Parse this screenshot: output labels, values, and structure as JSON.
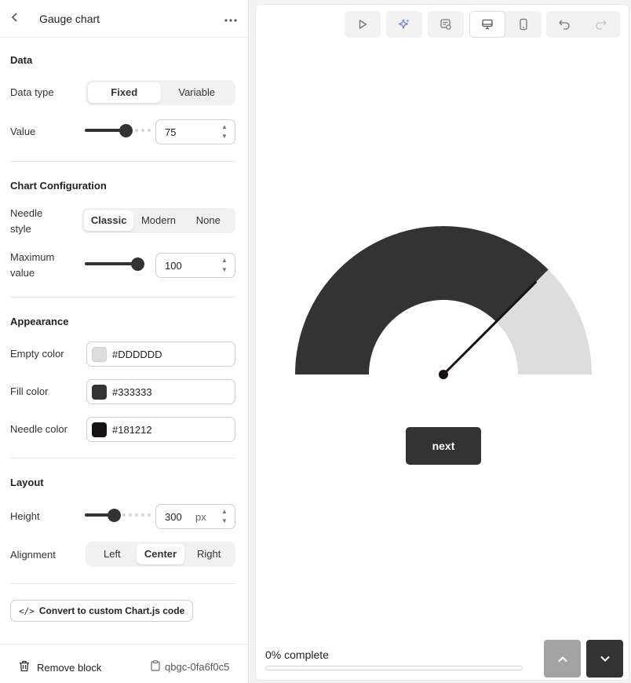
{
  "panel": {
    "title": "Gauge chart",
    "sections": {
      "data": "Data",
      "chart_config": "Chart Configuration",
      "appearance": "Appearance",
      "layout": "Layout"
    },
    "data_type": {
      "label": "Data type",
      "options": [
        "Fixed",
        "Variable"
      ],
      "selected": "Fixed"
    },
    "value": {
      "label": "Value",
      "value": "75",
      "slider_fraction": 0.75
    },
    "needle_style": {
      "label_line1": "Needle",
      "label_line2": "style",
      "options": [
        "Classic",
        "Modern",
        "None"
      ],
      "selected": "Classic"
    },
    "max_value": {
      "label_line1": "Maximum",
      "label_line2": "value",
      "value": "100",
      "slider_fraction": 1.0
    },
    "empty_color": {
      "label": "Empty color",
      "hex": "#DDDDDD"
    },
    "fill_color": {
      "label": "Fill color",
      "hex": "#333333"
    },
    "needle_color": {
      "label": "Needle color",
      "hex": "#181212"
    },
    "height": {
      "label": "Height",
      "value": "300",
      "unit": "px",
      "slider_fraction": 0.5
    },
    "alignment": {
      "label": "Alignment",
      "options": [
        "Left",
        "Center",
        "Right"
      ],
      "selected": "Center"
    },
    "convert_label": "Convert to custom Chart.js code",
    "remove_label": "Remove block",
    "block_id": "qbgc-0fa6f0c5"
  },
  "canvas": {
    "toolbar_icons": [
      "play-icon",
      "sparkle-icon",
      "preview-icon",
      "desktop-icon",
      "mobile-icon",
      "undo-icon",
      "redo-icon"
    ],
    "next_label": "next",
    "progress_text": "0% complete",
    "progress_fraction": 0
  },
  "chart_data": {
    "type": "gauge",
    "value": 75,
    "max": 100,
    "empty_color": "#DDDDDD",
    "fill_color": "#333333",
    "needle_color": "#181212"
  }
}
